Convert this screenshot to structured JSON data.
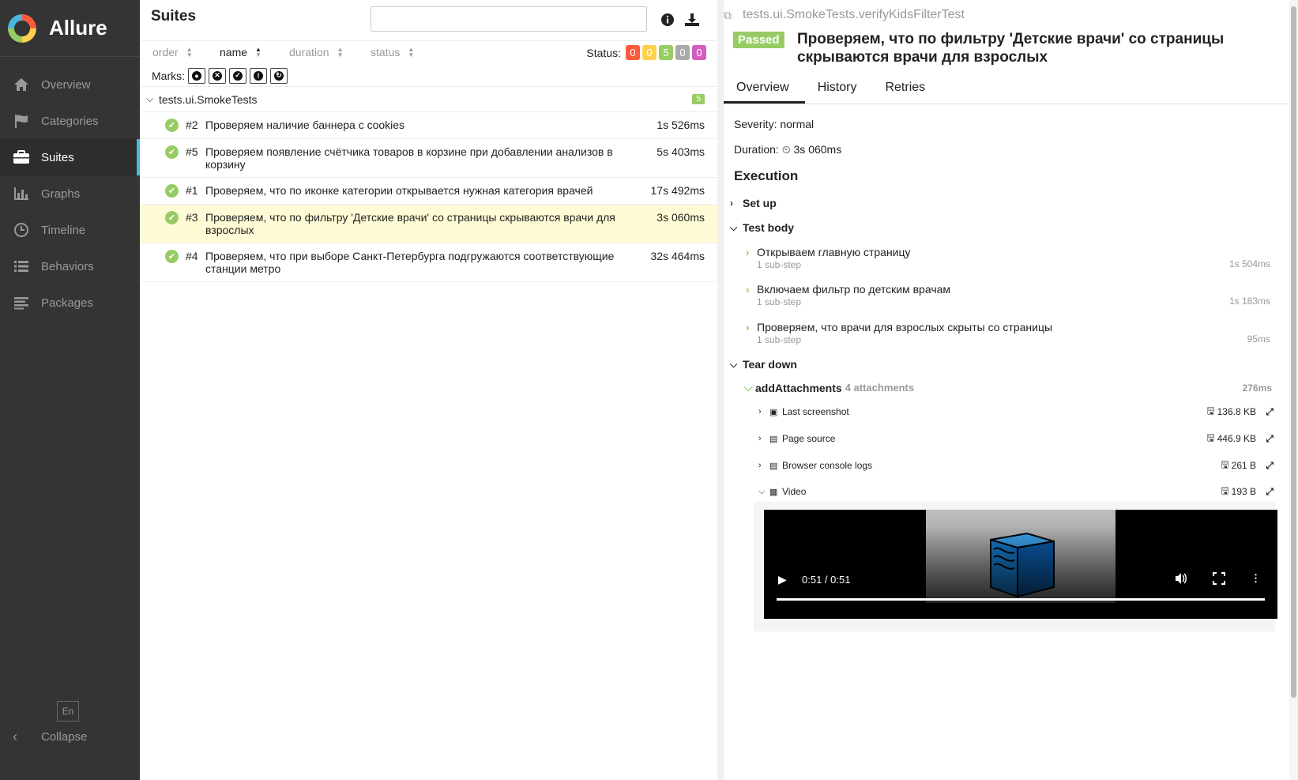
{
  "brand": {
    "name": "Allure"
  },
  "nav": [
    {
      "label": "Overview",
      "icon": "home-icon"
    },
    {
      "label": "Categories",
      "icon": "flag-icon"
    },
    {
      "label": "Suites",
      "icon": "briefcase-icon",
      "active": true
    },
    {
      "label": "Graphs",
      "icon": "bar-chart-icon"
    },
    {
      "label": "Timeline",
      "icon": "clock-icon"
    },
    {
      "label": "Behaviors",
      "icon": "list-icon"
    },
    {
      "label": "Packages",
      "icon": "align-left-icon"
    }
  ],
  "sidebar_footer": {
    "lang": "En",
    "collapse": "Collapse"
  },
  "suites": {
    "title": "Suites",
    "search_placeholder": "",
    "sort": {
      "order": "order",
      "name": "name",
      "duration": "duration",
      "status": "status",
      "active": "name"
    },
    "status_label": "Status:",
    "status_counts": [
      {
        "value": "0",
        "color": "#fd5a3e"
      },
      {
        "value": "0",
        "color": "#ffd050"
      },
      {
        "value": "5",
        "color": "#97cc64"
      },
      {
        "value": "0",
        "color": "#aaaaaa"
      },
      {
        "value": "0",
        "color": "#d35ebe"
      }
    ],
    "marks_label": "Marks:",
    "group": {
      "name": "tests.ui.SmokeTests",
      "count": "5"
    },
    "tests": [
      {
        "num": "#2",
        "name": "Проверяем наличие баннера с cookies",
        "duration": "1s 526ms"
      },
      {
        "num": "#5",
        "name": "Проверяем появление счётчика товаров в корзине при добавлении анализов в корзину",
        "duration": "5s 403ms"
      },
      {
        "num": "#1",
        "name": "Проверяем, что по иконке категории открывается нужная категория врачей",
        "duration": "17s 492ms"
      },
      {
        "num": "#3",
        "name": "Проверяем, что по фильтру 'Детские врачи' со страницы скрываются врачи для взрослых",
        "duration": "3s 060ms",
        "selected": true
      },
      {
        "num": "#4",
        "name": "Проверяем, что при выборе Санкт-Петербурга подгружаются соответствующие станции метро",
        "duration": "32s 464ms"
      }
    ]
  },
  "detail": {
    "path": "tests.ui.SmokeTests.verifyKidsFilterTest",
    "status": "Passed",
    "title": "Проверяем, что по фильтру 'Детские врачи' со страницы скрываются врачи для взрослых",
    "tabs": [
      "Overview",
      "History",
      "Retries"
    ],
    "severity_label": "Severity:",
    "severity": "normal",
    "duration_label": "Duration:",
    "duration": "3s 060ms",
    "execution_title": "Execution",
    "setup": "Set up",
    "test_body": "Test body",
    "steps": [
      {
        "name": "Открываем главную страницу",
        "sub": "1 sub-step",
        "duration": "1s 504ms"
      },
      {
        "name": "Включаем фильтр по детским врачам",
        "sub": "1 sub-step",
        "duration": "1s 183ms"
      },
      {
        "name": "Проверяем, что врачи для взрослых скрыты со страницы",
        "sub": "1 sub-step",
        "duration": "95ms"
      }
    ],
    "teardown": "Tear down",
    "attachments_step": {
      "name": "addAttachments",
      "count": "4 attachments",
      "duration": "276ms"
    },
    "attachments": [
      {
        "name": "Last screenshot",
        "size": "136.8 KB",
        "icon": "image-icon"
      },
      {
        "name": "Page source",
        "size": "446.9 KB",
        "icon": "file-icon"
      },
      {
        "name": "Browser console logs",
        "size": "261 B",
        "icon": "file-icon"
      },
      {
        "name": "Video",
        "size": "193 B",
        "icon": "video-file-icon",
        "expanded": true
      }
    ],
    "video": {
      "time": "0:51 / 0:51",
      "progress": 1.0
    }
  }
}
